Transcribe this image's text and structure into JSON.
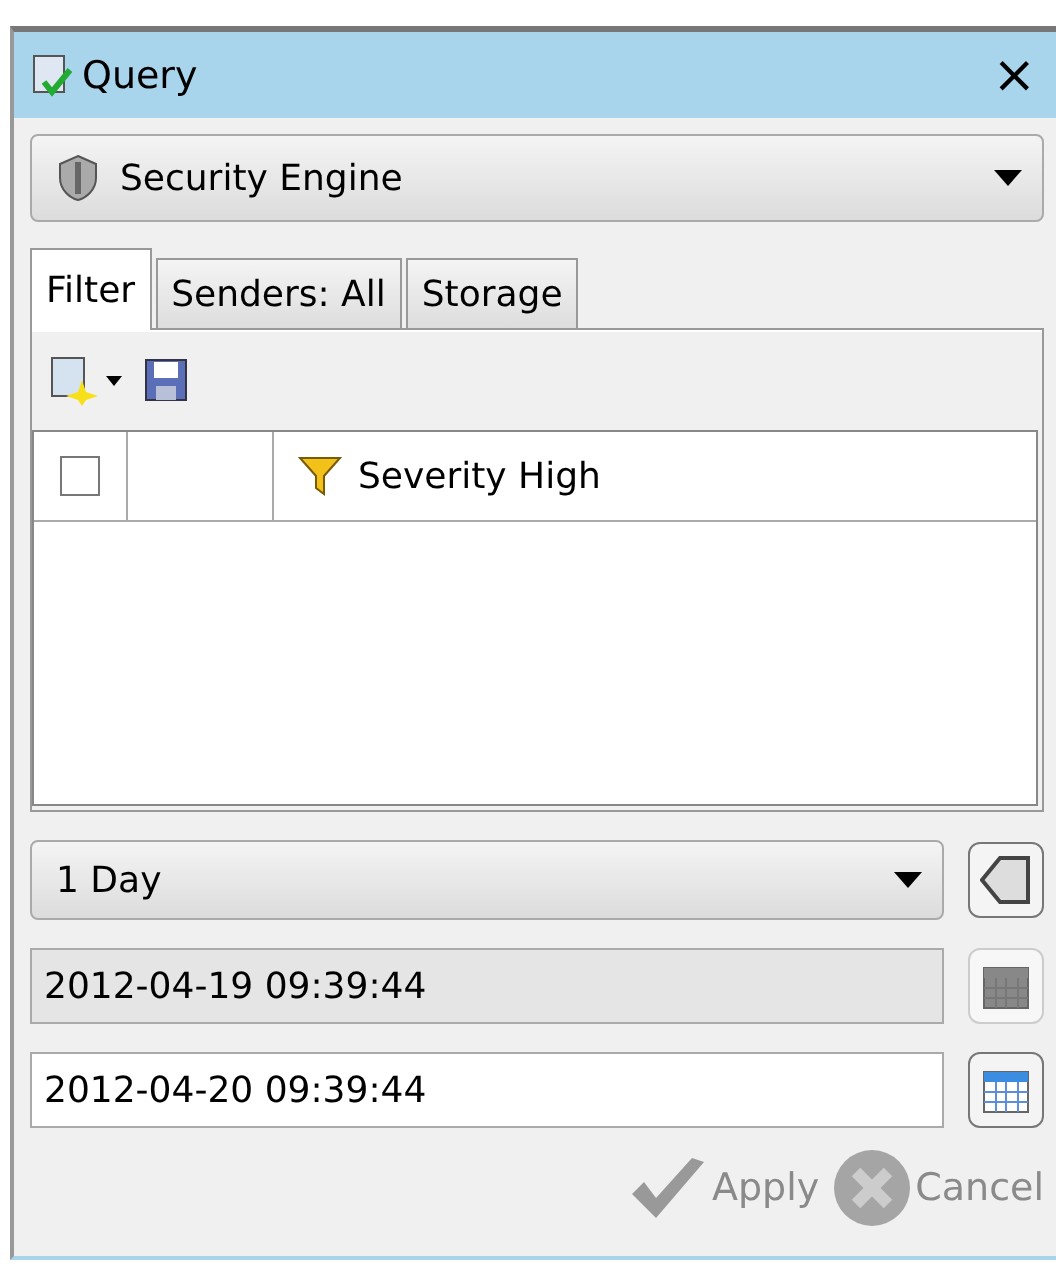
{
  "window": {
    "title": "Query",
    "close": "×"
  },
  "engine": {
    "value": "Security Engine"
  },
  "tabs": [
    {
      "label": "Filter",
      "selected": true
    },
    {
      "label": "Senders: All",
      "selected": false
    },
    {
      "label": "Storage",
      "selected": false
    }
  ],
  "filters": [
    {
      "checked": false,
      "name": "Severity High"
    }
  ],
  "range": {
    "value": "1 Day"
  },
  "start": {
    "value": "2012-04-19 09:39:44",
    "disabled": true
  },
  "end": {
    "value": "2012-04-20 09:39:44",
    "disabled": false
  },
  "buttons": [
    {
      "kind": "apply",
      "label": "Apply",
      "disabled": true
    },
    {
      "kind": "cancel",
      "label": "Cancel",
      "disabled": true
    }
  ]
}
